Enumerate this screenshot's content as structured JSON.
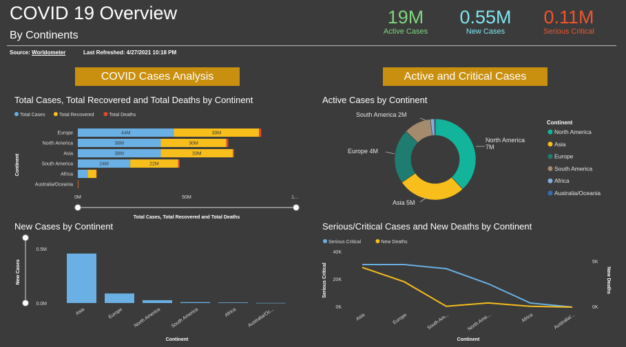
{
  "header": {
    "title": "COVID 19 Overview",
    "subtitle": "By Continents",
    "source_prefix": "Source:",
    "source_link": "Worldometer",
    "last_refreshed": "Last Refreshed: 4/27/2021 10:18 PM"
  },
  "kpis": [
    {
      "value": "19M",
      "label": "Active Cases",
      "color": "#7ed67e"
    },
    {
      "value": "0.55M",
      "label": "New Cases",
      "color": "#7fe6ef"
    },
    {
      "value": "0.11M",
      "label": "Serious Critical",
      "color": "#f2542d"
    }
  ],
  "banners": {
    "left": "COVID Cases Analysis",
    "right": "Active and Critical Cases"
  },
  "colors": {
    "blue": "#6ab0e4",
    "yellow": "#f7be1c",
    "red": "#e4482b",
    "teal": "#12b59b",
    "dark_teal": "#1e7d70",
    "brown": "#a58b6e",
    "light_blue": "#7faee0",
    "dark_blue": "#2f6fb3"
  },
  "chart_data": [
    {
      "type": "bar",
      "orientation": "horizontal-stacked",
      "title": "Total Cases, Total Recovered and Total Deaths by Continent",
      "xlabel": "Total Cases, Total Recovered and Total Deaths",
      "ylabel": "Continent",
      "categories": [
        "Europe",
        "North America",
        "Asia",
        "South America",
        "Africa",
        "Australia/Oceania"
      ],
      "series": [
        {
          "name": "Total Cases",
          "values": [
            44,
            38,
            38,
            24,
            4.5,
            0.05
          ],
          "labels": [
            "44M",
            "38M",
            "38M",
            "24M",
            "",
            ""
          ]
        },
        {
          "name": "Total Recovered",
          "values": [
            39,
            30,
            33,
            22,
            4,
            0.04
          ],
          "labels": [
            "39M",
            "30M",
            "33M",
            "22M",
            "",
            ""
          ]
        },
        {
          "name": "Total Deaths",
          "values": [
            1,
            0.9,
            0.6,
            0.6,
            0.1,
            0.001
          ],
          "labels": [
            "",
            "",
            "",
            "",
            "",
            ""
          ]
        }
      ],
      "x_ticks": [
        "0M",
        "50M",
        "1..."
      ],
      "xlim": [
        0,
        100
      ]
    },
    {
      "type": "pie",
      "title": "Active Cases by Continent",
      "legend_title": "Continent",
      "labels": [
        "North America",
        "Asia",
        "Europe",
        "South America",
        "Africa",
        "Australia/Oceania"
      ],
      "values": [
        7,
        5,
        4,
        2,
        0.3,
        0.05
      ],
      "slice_labels": [
        "North America\n7M",
        "Asia 5M",
        "Europe 4M",
        "South America 2M",
        "",
        ""
      ],
      "colors": [
        "#12b59b",
        "#f7be1c",
        "#1e7d70",
        "#a58b6e",
        "#7faee0",
        "#2f6fb3"
      ]
    },
    {
      "type": "bar",
      "title": "New Cases by Continent",
      "xlabel": "Continent",
      "ylabel": "New Cases",
      "categories": [
        "Asia",
        "Europe",
        "North America",
        "South America",
        "Africa",
        "Australia/Oc..."
      ],
      "values": [
        0.44,
        0.085,
        0.025,
        0.008,
        0.005,
        0.001
      ],
      "y_ticks": [
        "0.5M",
        "0.0M"
      ],
      "ylim": [
        0,
        0.55
      ]
    },
    {
      "type": "line",
      "title": "Serious/Critical Cases and New Deaths by Continent",
      "xlabel": "Continent",
      "ylabel": "Serious Critical",
      "y2label": "New Deaths",
      "categories": [
        "Asia",
        "Europe",
        "South Am...",
        "North Ame...",
        "Africa",
        "Australia/..."
      ],
      "series": [
        {
          "name": "Serious Critical",
          "axis": "left",
          "values": [
            31000,
            31000,
            28000,
            17000,
            3000,
            50
          ]
        },
        {
          "name": "New Deaths",
          "axis": "right",
          "values": [
            4700,
            3000,
            100,
            500,
            100,
            5
          ]
        }
      ],
      "y_ticks": [
        "40K",
        "20K",
        "0K"
      ],
      "y2_ticks": [
        "5K",
        "0K"
      ],
      "ylim": [
        0,
        40000
      ],
      "y2lim": [
        0,
        6500
      ]
    }
  ]
}
